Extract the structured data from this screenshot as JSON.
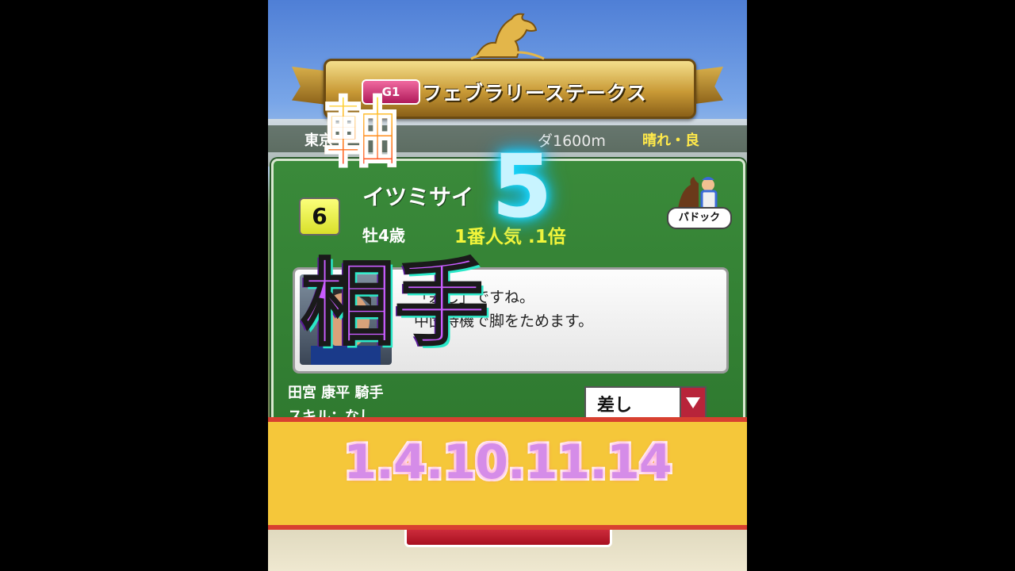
{
  "race": {
    "grade": "G1",
    "name": "フェブラリーステークス",
    "venue": "東京",
    "distance": "ダ1600m",
    "weather": "晴れ・良"
  },
  "horse": {
    "gate_number": "6",
    "name": "イツミサイ",
    "sex_age": "牡4歳",
    "popularity": "1番人気 .1倍",
    "paddock_label": "パドック"
  },
  "jockey": {
    "message_line1": "「差し」ですね。",
    "message_line2": "中団待機で脚をためます。",
    "name": "田宮 康平 騎手",
    "skill": "スキル：なし",
    "strategy": "差し"
  },
  "overlay": {
    "axis_label": "軸",
    "axis_number": "5",
    "partner_label": "相手",
    "partner_numbers": "1.4.10.11.14"
  },
  "colors": {
    "panel_green": "#2f7a30",
    "gold": "#c99a36",
    "yellow_band": "#f5c73a",
    "neon_cyan": "#19d8ff",
    "partner_purple": "#c85cff"
  }
}
